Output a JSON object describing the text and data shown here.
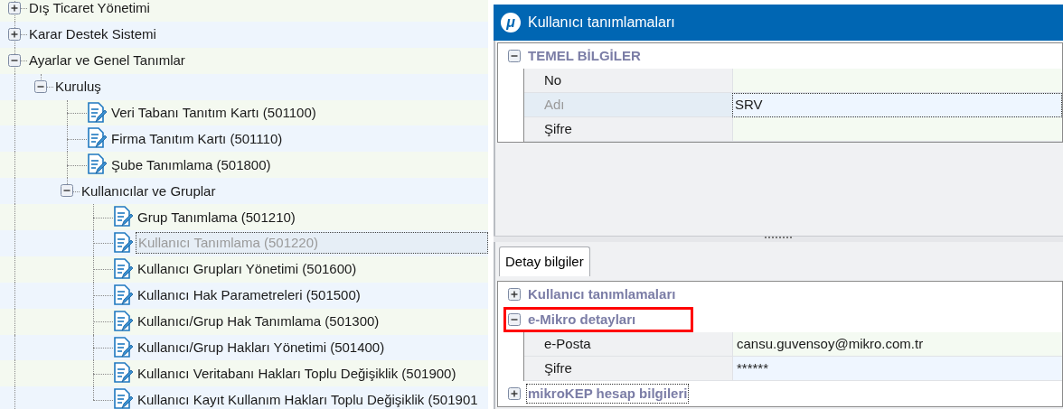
{
  "tree": [
    {
      "label": "Dış Ticaret Yönetimi",
      "expanded": false,
      "selected": false
    },
    {
      "label": "Karar Destek Sistemi",
      "expanded": false,
      "selected": false
    },
    {
      "label": "Ayarlar ve Genel Tanımlar",
      "expanded": true,
      "selected": false,
      "children": [
        {
          "label": "Kuruluş",
          "expanded": true,
          "selected": false,
          "children": [
            {
              "label": "Veri Tabanı Tanıtım Kartı (501100)",
              "selected": false
            },
            {
              "label": "Firma Tanıtım Kartı (501110)",
              "selected": false
            },
            {
              "label": "Şube Tanımlama (501800)",
              "selected": false
            },
            {
              "label": "Kullanıcılar ve Gruplar",
              "expanded": true,
              "selected": false,
              "children": [
                {
                  "label": "Grup Tanımlama (501210)",
                  "selected": false
                },
                {
                  "label": "Kullanıcı Tanımlama (501220)",
                  "selected": true
                },
                {
                  "label": "Kullanıcı Grupları Yönetimi (501600)",
                  "selected": false
                },
                {
                  "label": "Kullanıcı Hak Parametreleri (501500)",
                  "selected": false
                },
                {
                  "label": "Kullanıcı/Grup Hak Tanımlama (501300)",
                  "selected": false
                },
                {
                  "label": "Kullanıcı/Grup Hakları Yönetimi (501400)",
                  "selected": false
                },
                {
                  "label": "Kullanıcı Veritabanı Hakları Toplu Değişiklik (501900)",
                  "selected": false
                },
                {
                  "label": "Kullanıcı Kayıt Kullanım Hakları Toplu Değişiklik (501901",
                  "selected": false
                }
              ]
            }
          ]
        }
      ]
    }
  ],
  "window": {
    "logo": "μ",
    "title": "Kullanıcı tanımlamaları"
  },
  "main_grid": {
    "categories": [
      {
        "label": "TEMEL BİLGİLER",
        "expanded": true,
        "highlighted": false,
        "focused": false,
        "rows": [
          {
            "label": "No",
            "selected": false
          },
          {
            "label": "Adı",
            "value": "SRV",
            "selected": true
          },
          {
            "label": "Şifre",
            "selected": false
          }
        ]
      }
    ]
  },
  "tabs": [
    {
      "label": "Detay bilgiler",
      "selected": true
    }
  ],
  "detail_grid": {
    "categories": [
      {
        "label": "Kullanıcı tanımlamaları",
        "expanded": false,
        "highlighted": false,
        "focused": false
      },
      {
        "label": "e-Mikro detayları",
        "expanded": true,
        "highlighted": true,
        "focused": false,
        "rows": [
          {
            "label": "e-Posta",
            "value": "cansu.guvensoy@mikro.com.tr",
            "selected": false
          },
          {
            "label": "Şifre",
            "value": "******",
            "selected": false
          }
        ]
      },
      {
        "label": "mikroKEP hesap bilgileri",
        "expanded": false,
        "highlighted": false,
        "focused": true
      }
    ]
  }
}
